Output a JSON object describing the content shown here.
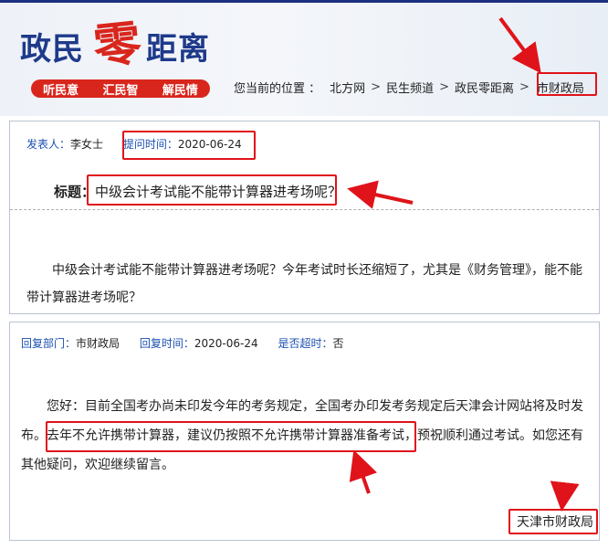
{
  "header": {
    "logo_left": "政民",
    "logo_zero": "零",
    "logo_right": "距离",
    "slogans": [
      "听民意",
      "汇民智",
      "解民情"
    ]
  },
  "breadcrumb": {
    "lead": "您当前的位置 ：",
    "items": [
      "北方网",
      "民生频道",
      "政民零距离",
      "市财政局"
    ],
    "separator": ">"
  },
  "question": {
    "author_label": "发表人：",
    "author": "李女士",
    "time_label": "提问时间：",
    "time": "2020-06-24",
    "title_label": "标题：",
    "title": "中级会计考试能不能带计算器进考场呢？",
    "body": "中级会计考试能不能带计算器进考场呢？今年考试时长还缩短了，尤其是《财务管理》，能不能带计算器进考场呢？"
  },
  "reply": {
    "dept_label": "回复部门：",
    "dept": "市财政局",
    "time_label": "回复时间：",
    "time": "2020-06-24",
    "overdue_label": "是否超时：",
    "overdue": "否",
    "body_1": "您好：目前全国考办尚未印发今年的考务规定，全国考办印发考务规定后天津会计网站将及时发布。",
    "body_highlight": "去年不允许携带计算器，建议仍按照不允许携带计算器准备考试，",
    "body_2": "预祝顺利通过考试。如您还有其他疑问，欢迎继续留言。",
    "signature": "天津市财政局"
  },
  "colors": {
    "brand_blue": "#1e3a8a",
    "brand_red": "#d9261c",
    "link_blue": "#1a4fb0",
    "highlight_red": "#e0131a"
  }
}
